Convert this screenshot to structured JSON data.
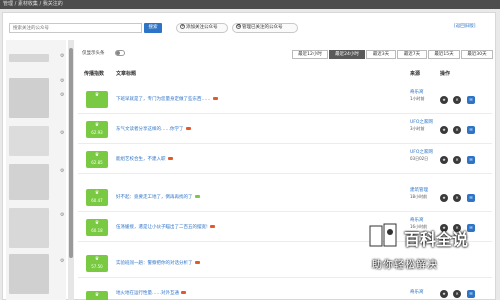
{
  "breadcrumb": "管理 / 素材收集 / 我关注的",
  "search": {
    "placeholder": "搜索关注的公众号",
    "button": "搜索"
  },
  "buttons": {
    "add_follow": "添加关注公众号",
    "manage_follow": "管理已关注的公众号",
    "reload": "[返回旧版]"
  },
  "toggle_label": "仅显示头条",
  "timeframes": [
    "最近12小时",
    "最近24小时",
    "最近3天",
    "最近7天",
    "最近15天",
    "最近30天"
  ],
  "active_timeframe": "最近24小时",
  "headers": {
    "score": "传播指数",
    "title": "文章标题",
    "source": "来源",
    "action": "操作"
  },
  "rows": [
    {
      "score": "",
      "title": "下班早就是了，专门为您量身定做了些东西……",
      "source": "奇乐窝",
      "time": "1小时前"
    },
    {
      "score": "62.93",
      "title": "东气文读者分享这样的……你学了",
      "source": "UFO之家网",
      "time": "3小时前"
    },
    {
      "score": "62.85",
      "title": "能组艺校合生，不建入职",
      "source": "UFO之家网",
      "time": "03日02日"
    },
    {
      "score": "60.47",
      "title": "好不起：竟要走工地了，倒再再找的了",
      "source": "建筑管理",
      "time": "18小时前"
    },
    {
      "score": "60.18",
      "title": "伍涤媛接，遣是让小伙子瞄出了二百五的摆宽!",
      "source": "奇乐窝",
      "time": "16小时前"
    },
    {
      "score": "57.50",
      "title": "实验班闯一趟：警察把你的对话分析了",
      "source": "",
      "time": ""
    },
    {
      "score": "",
      "title": "地火地在运行性量……对外互通",
      "source": "奇乐窝",
      "time": ""
    }
  ],
  "watermark": {
    "big": "百科全说",
    "small": "助你轻松解决"
  }
}
